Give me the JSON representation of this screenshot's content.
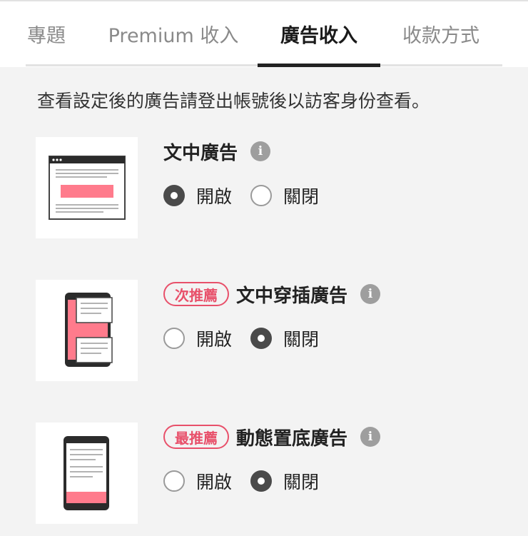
{
  "tabs": [
    {
      "label": "專題",
      "active": false
    },
    {
      "label": "Premium 收入",
      "active": false
    },
    {
      "label": "廣告收入",
      "active": true
    },
    {
      "label": "收款方式",
      "active": false
    }
  ],
  "notice": "查看設定後的廣告請登出帳號後以訪客身份查看。",
  "ad_settings": [
    {
      "badge": "",
      "title": "文中廣告",
      "info_icon": "info-icon",
      "options": [
        {
          "label": "開啟",
          "checked": true
        },
        {
          "label": "關閉",
          "checked": false
        }
      ]
    },
    {
      "badge": "次推薦",
      "title": "文中穿插廣告",
      "info_icon": "info-icon",
      "options": [
        {
          "label": "開啟",
          "checked": false
        },
        {
          "label": "關閉",
          "checked": true
        }
      ]
    },
    {
      "badge": "最推薦",
      "title": "動態置底廣告",
      "info_icon": "info-icon",
      "options": [
        {
          "label": "開啟",
          "checked": false
        },
        {
          "label": "關閉",
          "checked": true
        }
      ]
    }
  ],
  "info_icon_glyph": "i",
  "colors": {
    "accent_pink": "#ff7b8c",
    "badge_red": "#e8506a",
    "radio_checked": "#4a4a4a",
    "active_tab_bar": "#222222"
  }
}
